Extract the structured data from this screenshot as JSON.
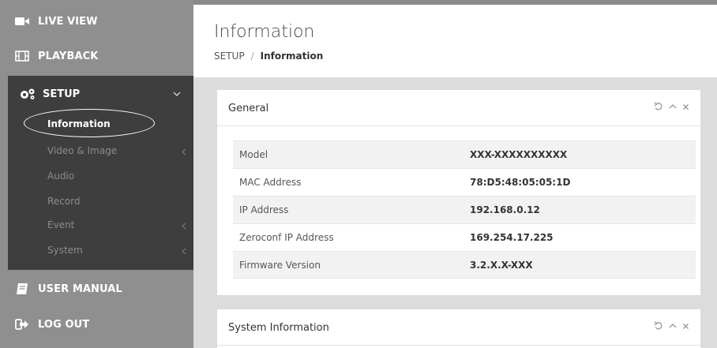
{
  "sidebar": {
    "live_view": "LIVE VIEW",
    "playback": "PLAYBACK",
    "setup": "SETUP",
    "setup_items": [
      {
        "label": "Information"
      },
      {
        "label": "Video & Image"
      },
      {
        "label": "Audio"
      },
      {
        "label": "Record"
      },
      {
        "label": "Event"
      },
      {
        "label": "System"
      }
    ],
    "user_manual": "USER MANUAL",
    "log_out": "LOG OUT"
  },
  "header": {
    "title": "Information",
    "breadcrumb_root": "SETUP",
    "breadcrumb_sep": "/",
    "breadcrumb_current": "Information"
  },
  "general": {
    "title": "General",
    "rows": [
      {
        "label": "Model",
        "value": "XXX-XXXXXXXXXX"
      },
      {
        "label": "MAC Address",
        "value": "78:D5:48:05:05:1D"
      },
      {
        "label": "IP Address",
        "value": "192.168.0.12"
      },
      {
        "label": "Zeroconf IP Address",
        "value": "169.254.17.225"
      },
      {
        "label": "Firmware Version",
        "value": "3.2.X.X-XXX"
      }
    ]
  },
  "system_info": {
    "title": "System Information"
  },
  "colors": {
    "sidebar_bg": "#8f8f8f",
    "setup_panel_bg": "#3e3e3e",
    "content_bg": "#dcdcdc"
  },
  "icons": [
    "video-camera-icon",
    "film-icon",
    "gears-icon",
    "chevron-down-icon",
    "chevron-left-icon",
    "book-icon",
    "sign-out-icon",
    "refresh-icon",
    "collapse-icon",
    "close-icon"
  ]
}
